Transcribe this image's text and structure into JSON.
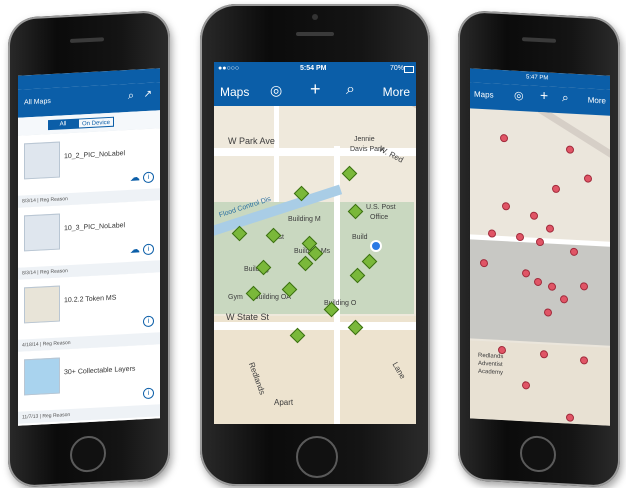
{
  "left_phone": {
    "nav_title": "All Maps",
    "segments": [
      "All",
      "On Device"
    ],
    "items": [
      {
        "title": "10_2_PIC_NoLabel",
        "footer": "8/3/14 | Reg Reason"
      },
      {
        "title": "10_3_PIC_NoLabel",
        "footer": "8/3/14 | Reg Reason"
      },
      {
        "title": "10.2.2 Token MS",
        "footer": "4/18/14 | Reg Reason"
      },
      {
        "title": "30+ Collectable Layers",
        "footer": "11/7/13 | Reg Reason"
      },
      {
        "title": "",
        "footer": ""
      }
    ]
  },
  "middle_phone": {
    "status": {
      "carrier": "●●○○○",
      "time": "5:54 PM",
      "battery": "70%"
    },
    "toolbar": {
      "maps_label": "Maps",
      "more_label": "More"
    },
    "map_labels": {
      "park_ave": "W Park Ave",
      "jennie": "Jennie",
      "davis_park": "Davis Park",
      "redlands_blvd": "W. Red",
      "flood_control": "Flood Control Dis",
      "us_post": "U.S. Post",
      "office": "Office",
      "building_m": "Building M",
      "building_ms": "Building Ms",
      "east": "East",
      "bldg": "Build",
      "building": "Building",
      "building_oa": "Building OA",
      "building_o": "Building O",
      "gym": "Gym",
      "state_st": "W State St",
      "redlands": "Redlands",
      "apart": "Apart",
      "lane": "Lane"
    }
  },
  "right_phone": {
    "status": {
      "time": "5:47 PM"
    },
    "toolbar": {
      "maps_label": "Maps",
      "more_label": "More"
    },
    "map_labels": {
      "redlands": "Redlands",
      "adventist": "Adventist",
      "academy": "Academy"
    }
  },
  "colors": {
    "brand": "#0b5ea8",
    "map_bg": "#efe9dc",
    "marker_green": "#7ab83a",
    "marker_red": "#e05566"
  }
}
